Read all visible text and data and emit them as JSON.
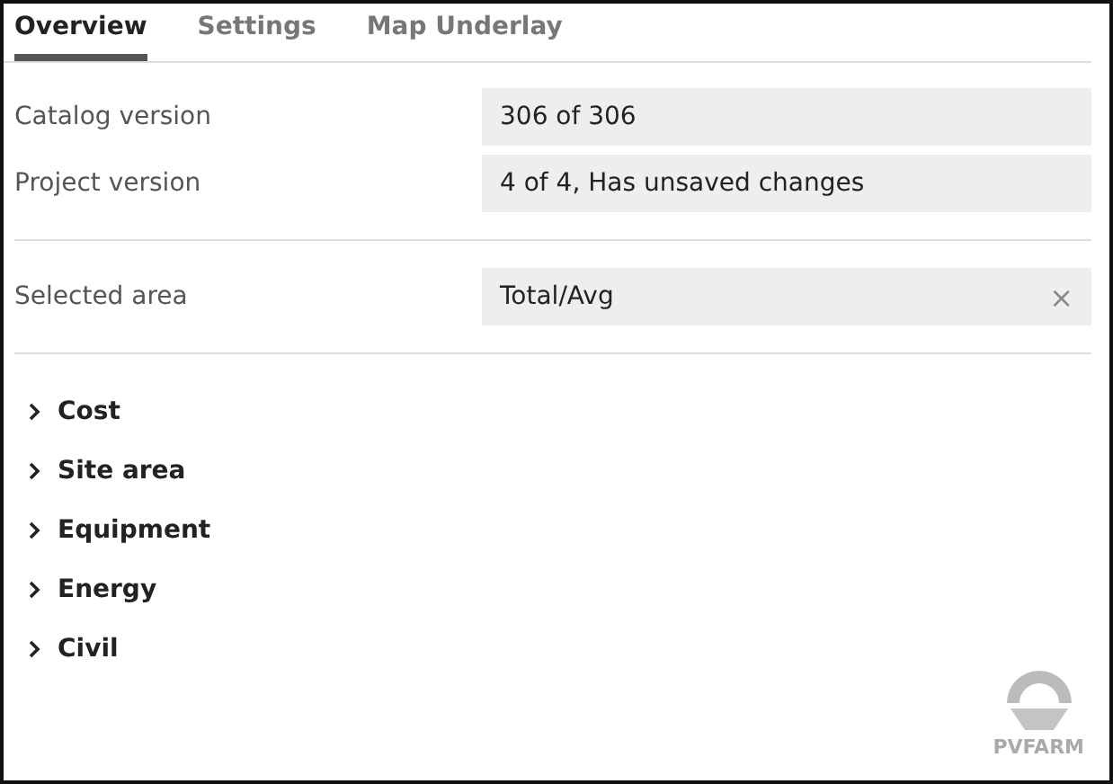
{
  "tabs": [
    {
      "label": "Overview",
      "selected": true
    },
    {
      "label": "Settings",
      "selected": false
    },
    {
      "label": "Map Underlay",
      "selected": false
    }
  ],
  "info_rows": [
    {
      "label": "Catalog version",
      "value": "306 of 306"
    },
    {
      "label": "Project version",
      "value": "4 of 4, Has unsaved changes"
    }
  ],
  "selected_area": {
    "label": "Selected area",
    "value": "Total/Avg",
    "clear": "×"
  },
  "sections": [
    {
      "label": "Cost",
      "expanded": false
    },
    {
      "label": "Site area",
      "expanded": false
    },
    {
      "label": "Equipment",
      "expanded": false
    },
    {
      "label": "Energy",
      "expanded": false
    },
    {
      "label": "Civil",
      "expanded": false
    }
  ],
  "logo": {
    "text": "PVFARM"
  }
}
